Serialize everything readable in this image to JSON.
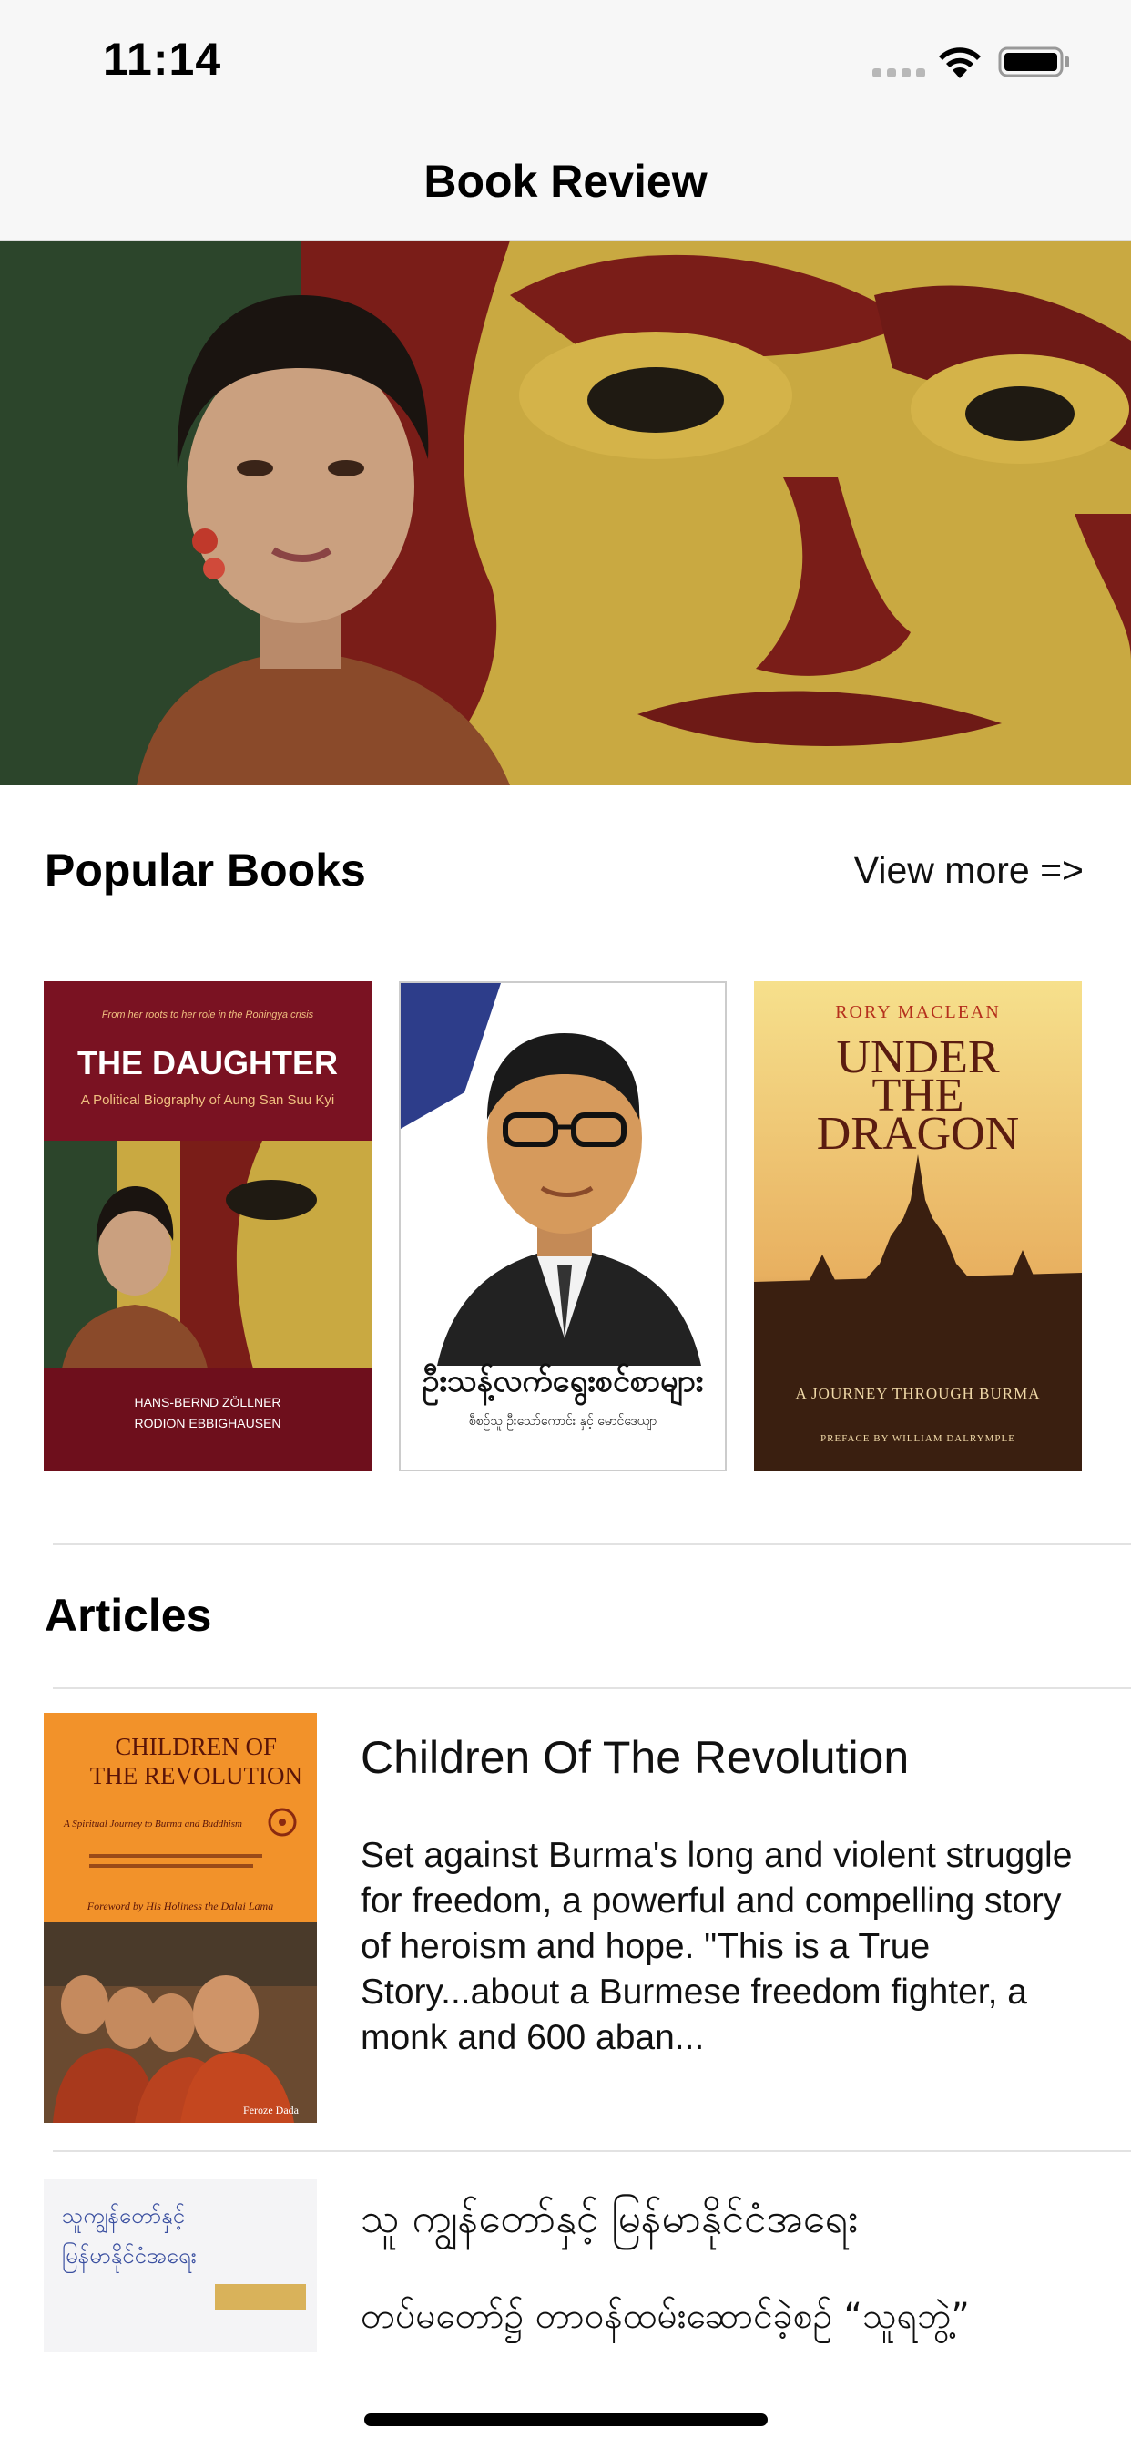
{
  "status_bar": {
    "time": "11:14"
  },
  "nav": {
    "title": "Book Review"
  },
  "popular": {
    "title": "Popular Books",
    "view_more": "View more =>",
    "books": [
      {
        "tagline": "From her roots to her role in the Rohingya crisis",
        "title": "THE DAUGHTER",
        "subtitle": "A Political Biography of Aung San Suu Kyi",
        "author1": "HANS-BERND ZÖLLNER",
        "author2": "RODION EBBIGHAUSEN"
      },
      {
        "title": "ဦးသန့်လက်ရွေးစင်စာများ",
        "subtitle": "စီစဉ်သူ ဦးသော်ကောင်း နှင့် မောင်ဒေယျာ"
      },
      {
        "author": "RORY MACLEAN",
        "title_line1": "UNDER",
        "title_line2": "THE",
        "title_line3": "DRAGON",
        "subtitle": "A JOURNEY THROUGH BURMA",
        "preface": "PREFACE BY WILLIAM DALRYMPLE"
      }
    ]
  },
  "articles": {
    "title": "Articles",
    "items": [
      {
        "cover_title_line1": "CHILDREN OF",
        "cover_title_line2": "THE REVOLUTION",
        "cover_subtitle": "A Spiritual Journey to Burma and Buddhism",
        "cover_foreword": "Foreword by His Holiness the Dalai Lama",
        "cover_author": "Feroze Dada",
        "title": "Children Of The Revolution",
        "description": "Set against Burma's long and violent struggle for freedom, a powerful and compelling story of heroism and hope. \"This is a True Story...about a Burmese freedom fighter, a monk and 600 aban..."
      },
      {
        "cover_title_line1": "သူကျွန်တော်နှင့်",
        "cover_title_line2": "မြန်မာနိုင်ငံအရေး",
        "title": "သူ ကျွန်တော်နှင့် မြန်မာနိုင်ငံအရေး",
        "description": "တပ်မတော်၌ တာဝန်ထမ်းဆောင်ခဲ့စဉ် “သူရဘွဲ့”"
      }
    ]
  },
  "colors": {
    "nav_background": "#f7f7f7",
    "divider": "#e2e2e2",
    "daughter_red": "#7a1222",
    "dragon_yellow": "#f2d77a",
    "revolution_orange": "#f2922a"
  }
}
